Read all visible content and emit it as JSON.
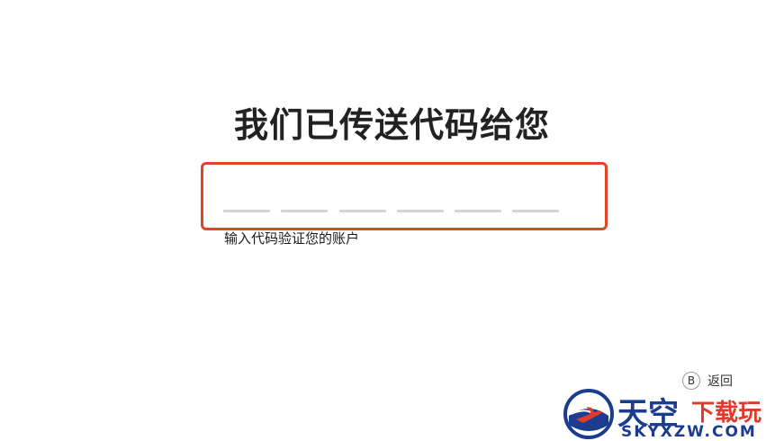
{
  "heading": "我们已传送代码给您",
  "hint": "输入代码验证您的账户",
  "code": {
    "digits": [
      "",
      "",
      "",
      "",
      "",
      ""
    ]
  },
  "back": {
    "key": "B",
    "label": "返回"
  },
  "watermark": {
    "cn_main": "天空",
    "cn_sub": "下载玩",
    "domain": "SKYXZW.COM"
  },
  "colors": {
    "focus_border": "#e0452a",
    "digit_line": "#d4d4d4",
    "logo_blue": "#1c3d8f",
    "logo_red": "#e23a2a"
  }
}
